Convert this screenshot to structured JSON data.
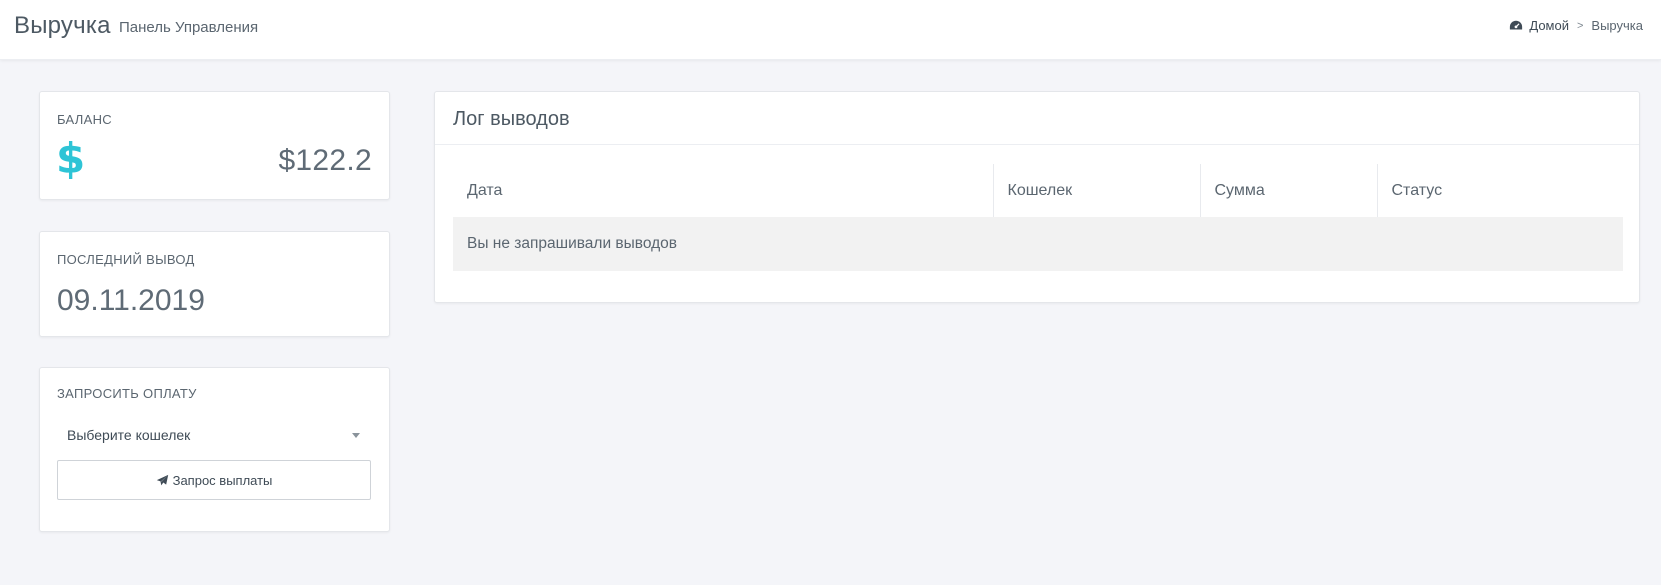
{
  "header": {
    "title": "Выручка",
    "subtitle": "Панель Управления",
    "breadcrumb": {
      "home": "Домой",
      "separator": ">",
      "current": "Выручка"
    }
  },
  "balance": {
    "label": "БАЛАНС",
    "icon": "dollar-icon",
    "symbol": "$",
    "value": "$122.2"
  },
  "last_withdrawal": {
    "label": "ПОСЛЕДНИЙ ВЫВОД",
    "value": "09.11.2019"
  },
  "request_payment": {
    "label": "ЗАПРОСИТЬ ОПЛАТУ",
    "wallet_select": "Выберите кошелек",
    "button_label": "Запрос выплаты"
  },
  "withdrawal_log": {
    "title": "Лог выводов",
    "columns": [
      "Дата",
      "Кошелек",
      "Сумма",
      "Статус"
    ],
    "empty_message": "Вы не запрашивали выводов"
  },
  "colors": {
    "accent": "#2ec4d6",
    "background": "#f4f5f9",
    "text": "#5f6b76"
  }
}
